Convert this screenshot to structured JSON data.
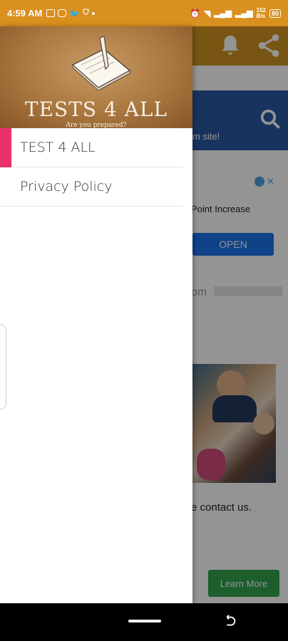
{
  "status_bar": {
    "time": "4:59 AM",
    "battery": "80",
    "net_speed_top": "152",
    "net_speed_bottom": "B/s"
  },
  "background_app": {
    "banner_text": "m site!",
    "ad_text": "Point Increase",
    "open_button": "OPEN",
    "faded_text": "om",
    "contact_text": "e contact us.",
    "learn_more_button": "Learn More"
  },
  "drawer": {
    "header": {
      "title": "TESTS 4 ALL",
      "subtitle": "Are you prepared?"
    },
    "items": [
      {
        "label": "TEST 4 ALL",
        "active": true
      },
      {
        "label": "Privacy Policy",
        "active": false
      }
    ]
  },
  "colors": {
    "status_bar": "#d9901e",
    "accent": "#ea2f6b",
    "open_button": "#1a73e8",
    "learn_more": "#31a24c"
  }
}
